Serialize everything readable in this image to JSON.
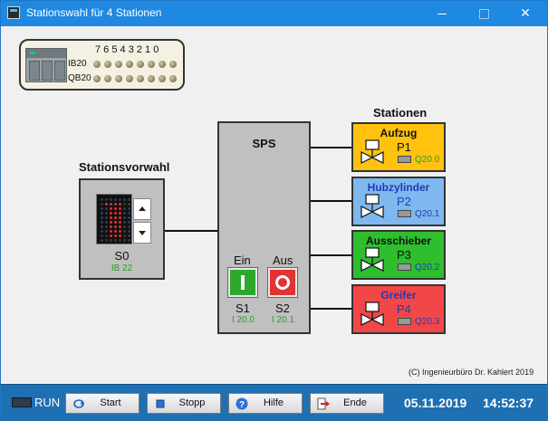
{
  "window": {
    "title": "Stationswahl für 4 Stationen",
    "controls": {
      "minimize": "—",
      "maximize": "☐",
      "close": "✕"
    }
  },
  "io_panel": {
    "bit_header": "7 6 5 4 3 2 1 0",
    "rows": [
      {
        "label": "IB20",
        "bits": [
          0,
          0,
          0,
          0,
          0,
          0,
          0,
          0
        ]
      },
      {
        "label": "QB20",
        "bits": [
          0,
          0,
          0,
          0,
          0,
          0,
          0,
          0
        ]
      }
    ]
  },
  "station_select": {
    "heading": "Stationsvorwahl",
    "selector_name": "S0",
    "selector_address": "IB 22",
    "display_digit": "1"
  },
  "sps": {
    "title": "SPS",
    "start_label": "Ein",
    "stop_label": "Aus",
    "start_name": "S1",
    "stop_name": "S2",
    "start_address": "I 20.0",
    "stop_address": "I 20.1"
  },
  "stations": {
    "heading": "Stationen",
    "items": [
      {
        "title": "Aufzug",
        "name": "P1",
        "address": "Q20.0",
        "color": "#ffc20e",
        "text_color": "#111111",
        "addr_color": "#2a9d2a"
      },
      {
        "title": "Hubzylinder",
        "name": "P2",
        "address": "Q20.1",
        "color": "#7fb8ee",
        "text_color": "#1d3db5",
        "addr_color": "#1d3db5"
      },
      {
        "title": "Ausschieber",
        "name": "P3",
        "address": "Q20.2",
        "color": "#2ebe2e",
        "text_color": "#111111",
        "addr_color": "#1d3db5"
      },
      {
        "title": "Greifer",
        "name": "P4",
        "address": "Q20.3",
        "color": "#f24747",
        "text_color": "#1d3db5",
        "addr_color": "#1d3db5"
      }
    ]
  },
  "copyright": "(C) Ingenieurbüro Dr. Kahlert 2019",
  "bottom_bar": {
    "run_label": "RUN",
    "buttons": [
      {
        "label": "Start",
        "icon": "start-loop-icon"
      },
      {
        "label": "Stopp",
        "icon": "stop-square-icon"
      },
      {
        "label": "Hilfe",
        "icon": "help-icon"
      },
      {
        "label": "Ende",
        "icon": "exit-arrow-icon"
      }
    ],
    "date": "05.11.2019",
    "time": "14:52:37"
  }
}
